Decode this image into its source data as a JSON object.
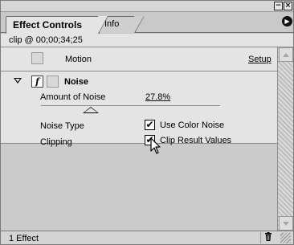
{
  "window": {
    "minimize_glyph": "−",
    "close_glyph": "×"
  },
  "tabs": [
    {
      "label": "Effect Controls",
      "active": true
    },
    {
      "label": "Info",
      "active": false
    }
  ],
  "panel_menu": {
    "glyph": "▶",
    "icon": "panel-menu-arrow-icon"
  },
  "clip": {
    "label": "clip @ 00;00;34;25"
  },
  "effects": {
    "motion": {
      "label": "Motion",
      "setup_label": "Setup"
    },
    "noise": {
      "fx_glyph": "f",
      "title": "Noise",
      "expanded": true,
      "amount": {
        "label": "Amount of Noise",
        "value": "27.8%",
        "level_percent": 27.8
      },
      "noise_type": {
        "label": "Noise Type",
        "checkbox_label": "Use Color Noise",
        "checked": true,
        "check_glyph": "✔"
      },
      "clipping": {
        "label": "Clipping",
        "checkbox_label": "Clip Result Values",
        "checked": true,
        "check_glyph": "✔"
      }
    }
  },
  "status": {
    "count_label": "1 Effect",
    "trash_glyph": "🗑"
  },
  "colors": {
    "panel_bg": "#c9c9c9",
    "row_bg": "#e4e4e4",
    "accent": "#000000"
  }
}
